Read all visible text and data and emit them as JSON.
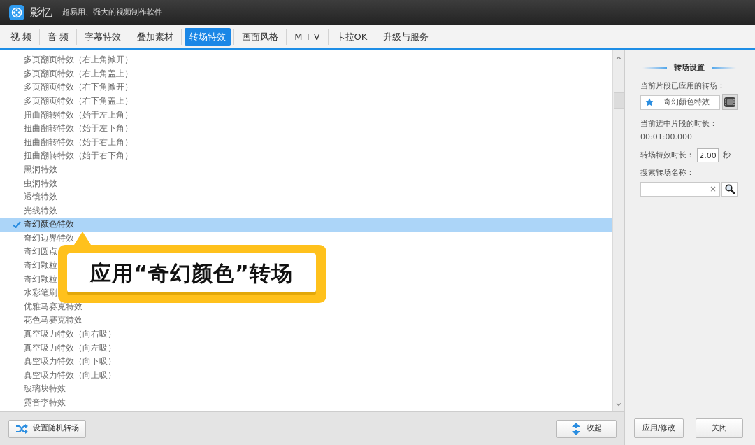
{
  "app": {
    "name": "影忆",
    "tagline": "超易用、强大的视频制作软件"
  },
  "tabs": [
    {
      "label": "视 频",
      "selected": false
    },
    {
      "label": "音 频",
      "selected": false
    },
    {
      "label": "字幕特效",
      "selected": false
    },
    {
      "label": "叠加素材",
      "selected": false
    },
    {
      "label": "转场特效",
      "selected": true
    },
    {
      "label": "画面风格",
      "selected": false
    },
    {
      "label": "M T V",
      "selected": false
    },
    {
      "label": "卡拉OK",
      "selected": false
    },
    {
      "label": "升级与服务",
      "selected": false
    }
  ],
  "transition_list": {
    "items": [
      {
        "label": "多页翻页特效（右上角掀开）",
        "selected": false
      },
      {
        "label": "多页翻页特效（右上角盖上）",
        "selected": false
      },
      {
        "label": "多页翻页特效（右下角掀开）",
        "selected": false
      },
      {
        "label": "多页翻页特效（右下角盖上）",
        "selected": false
      },
      {
        "label": "扭曲翻转特效（始于左上角）",
        "selected": false
      },
      {
        "label": "扭曲翻转特效（始于左下角）",
        "selected": false
      },
      {
        "label": "扭曲翻转特效（始于右上角）",
        "selected": false
      },
      {
        "label": "扭曲翻转特效（始于右下角）",
        "selected": false
      },
      {
        "label": "黑洞特效",
        "selected": false
      },
      {
        "label": "虫洞特效",
        "selected": false
      },
      {
        "label": "透镜特效",
        "selected": false
      },
      {
        "label": "光线特效",
        "selected": false
      },
      {
        "label": "奇幻颜色特效",
        "selected": true
      },
      {
        "label": "奇幻边界特效",
        "selected": false
      },
      {
        "label": "奇幻圆点",
        "selected": false
      },
      {
        "label": "奇幻颗粒",
        "selected": false
      },
      {
        "label": "奇幻颗粒",
        "selected": false
      },
      {
        "label": "水彩笔刷",
        "selected": false
      },
      {
        "label": "优雅马赛克特效",
        "selected": false
      },
      {
        "label": "花色马赛克特效",
        "selected": false
      },
      {
        "label": "真空吸力特效（向右吸）",
        "selected": false
      },
      {
        "label": "真空吸力特效（向左吸）",
        "selected": false
      },
      {
        "label": "真空吸力特效（向下吸）",
        "selected": false
      },
      {
        "label": "真空吸力特效（向上吸）",
        "selected": false
      },
      {
        "label": "玻璃块特效",
        "selected": false
      },
      {
        "label": "霓音李特效",
        "selected": false
      }
    ]
  },
  "callout": {
    "text": "应用“奇幻颜色”转场"
  },
  "bottom_bar": {
    "random_button": "设置随机转场",
    "collapse_button": "收起"
  },
  "settings_panel": {
    "title": "转场设置",
    "applied_label": "当前片段已应用的转场：",
    "applied_value": "奇幻颜色特效",
    "clip_duration_label": "当前选中片段的时长：",
    "clip_duration_value": "00:01:00.000",
    "effect_duration_label": "转场特效时长：",
    "effect_duration_value": "2.00",
    "effect_duration_unit": "秒",
    "search_label": "搜索转场名称：",
    "search_clear": "×",
    "buttons": [
      "应用/修改",
      "关闭"
    ]
  }
}
